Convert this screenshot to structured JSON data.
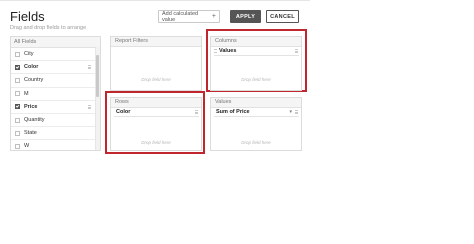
{
  "header": {
    "title": "Fields",
    "subtitle": "Drag and drop fields to arrange",
    "add_calculated_value_label": "Add calculated value",
    "add_icon": "plus-icon",
    "apply_label": "APPLY",
    "cancel_label": "CANCEL"
  },
  "all_fields": {
    "header": "All Fields",
    "items": [
      {
        "label": "City",
        "checked": false
      },
      {
        "label": "Color",
        "checked": true
      },
      {
        "label": "Country",
        "checked": false
      },
      {
        "label": "M",
        "checked": false
      },
      {
        "label": "Price",
        "checked": true
      },
      {
        "label": "Quantity",
        "checked": false
      },
      {
        "label": "State",
        "checked": false
      },
      {
        "label": "W",
        "checked": false
      }
    ]
  },
  "zones": {
    "report_filters": {
      "header": "Report Filters",
      "hint": "Drop field here"
    },
    "columns": {
      "header": "Columns",
      "chip": "Values",
      "hint": "Drop field here"
    },
    "rows": {
      "header": "Rows",
      "chip": "Color",
      "hint": "Drop field here"
    },
    "values": {
      "header": "Values",
      "chip": "Sum of Price",
      "hint": "Drop field here"
    }
  },
  "colors": {
    "highlight": "#c0262e",
    "apply_bg": "#555555"
  }
}
